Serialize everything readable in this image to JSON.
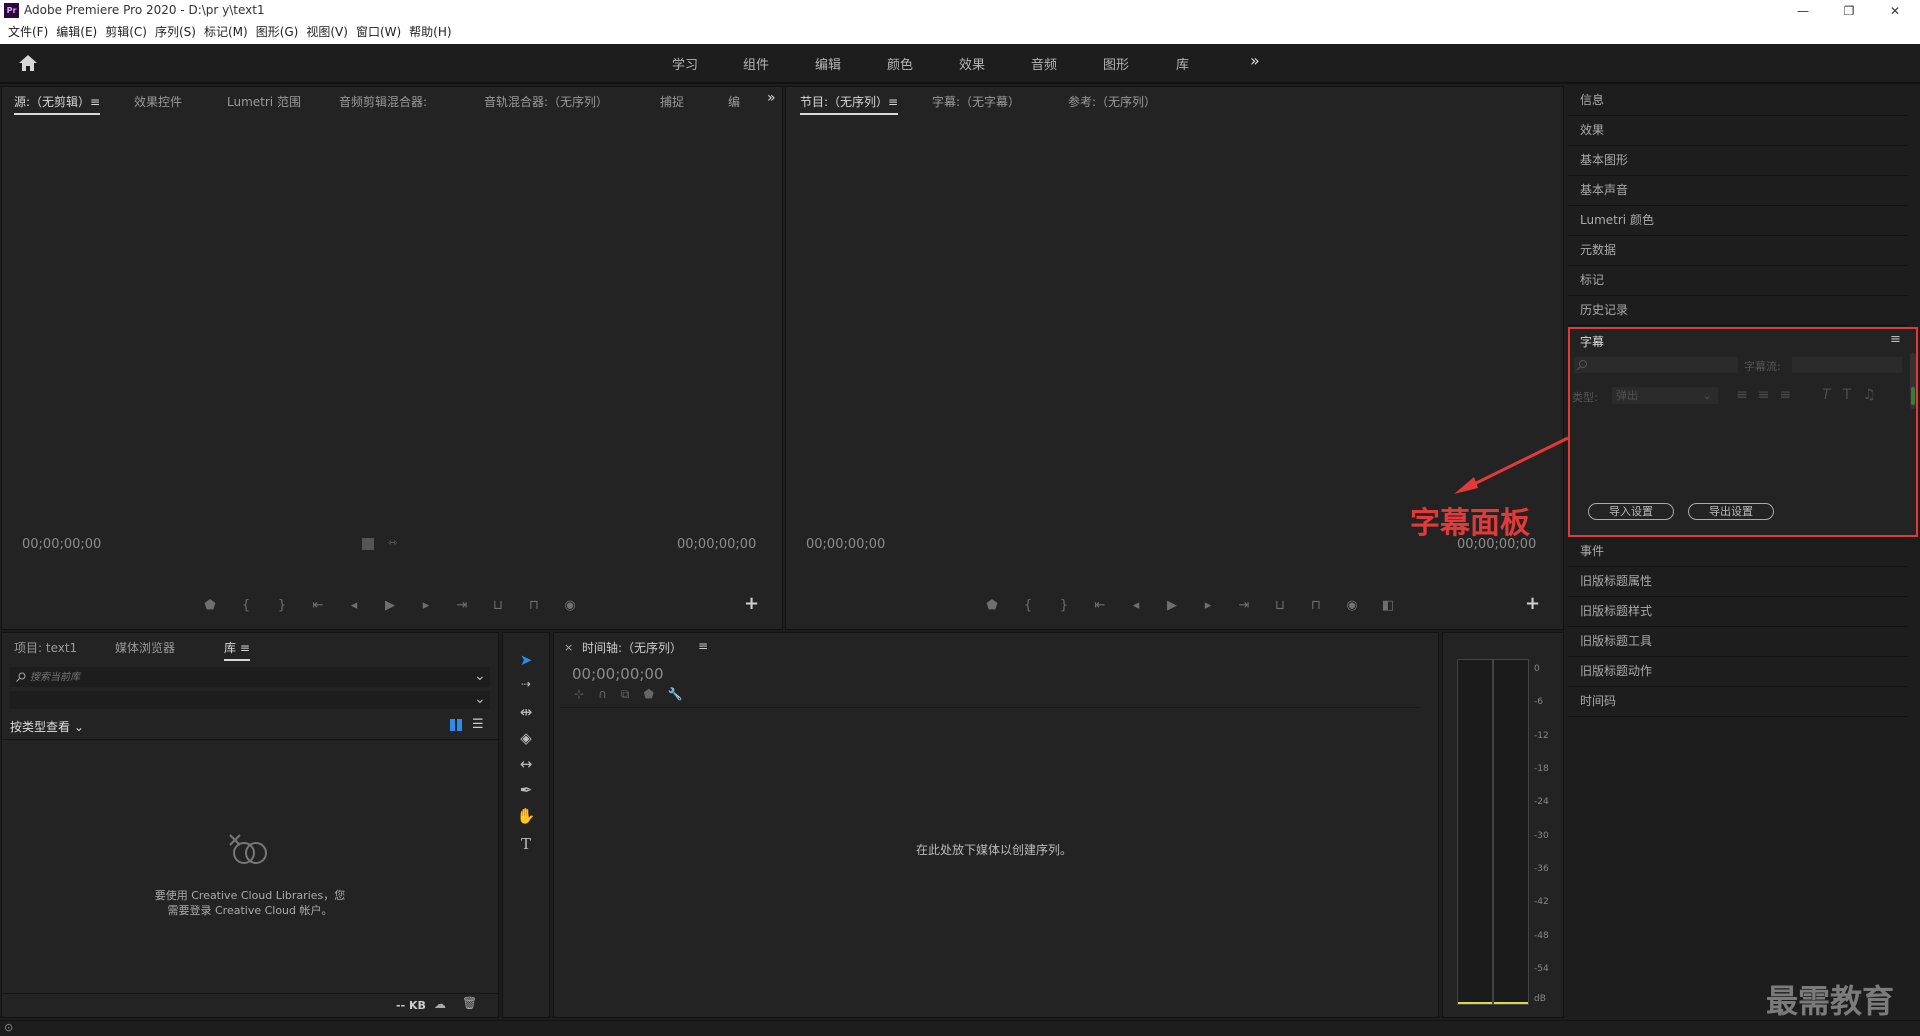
{
  "window": {
    "title": "Adobe Premiere Pro 2020 - D:\\pr y\\text1",
    "logo": "Pr",
    "min": "—",
    "restore": "❐",
    "close": "✕"
  },
  "menu": [
    "文件(F)",
    "编辑(E)",
    "剪辑(C)",
    "序列(S)",
    "标记(M)",
    "图形(G)",
    "视图(V)",
    "窗口(W)",
    "帮助(H)"
  ],
  "workspaces": [
    "学习",
    "组件",
    "编辑",
    "颜色",
    "效果",
    "音频",
    "图形",
    "库"
  ],
  "workspace_more": "»",
  "source_panel": {
    "tabs": [
      "源:（无剪辑）≡",
      "效果控件",
      "Lumetri 范围",
      "音频剪辑混合器:",
      "音轨混合器:（无序列）",
      "捕捉",
      "编"
    ],
    "more": "»",
    "tc_left": "00;00;00;00",
    "tc_right": "00;00;00;00"
  },
  "program_panel": {
    "tabs": [
      "节目:（无序列）≡",
      "字幕:（无字幕）",
      "参考:（无序列）"
    ],
    "tc_left": "00;00;00;00",
    "tc_right": "00;00;00;00"
  },
  "right_panels_top": [
    "信息",
    "效果",
    "基本图形",
    "基本声音",
    "Lumetri 颜色",
    "元数据",
    "标记",
    "历史记录"
  ],
  "captions_panel": {
    "title": "字幕",
    "menu": "≡",
    "stream_label": "字幕流:",
    "type_label": "类型:",
    "type_value": "弹出",
    "import_btn": "导入设置",
    "export_btn": "导出设置"
  },
  "annotation": "字幕面板",
  "right_panels_bottom": [
    "事件",
    "旧版标题属性",
    "旧版标题样式",
    "旧版标题工具",
    "旧版标题动作",
    "时间码"
  ],
  "project_panel": {
    "tabs": [
      "项目: text1",
      "媒体浏览器",
      "库"
    ],
    "search_placeholder": "搜索当前库",
    "view_by": "按类型查看",
    "message_line1": "要使用 Creative Cloud Libraries，您",
    "message_line2": "需要登录 Creative Cloud 帐户。",
    "size": "-- KB"
  },
  "timeline_panel": {
    "tab": "时间轴:（无序列）",
    "menu": "≡",
    "close": "×",
    "timecode": "00;00;00;00",
    "drop_message": "在此处放下媒体以创建序列。"
  },
  "audio_meter": {
    "labels": [
      "0",
      "-6",
      "-12",
      "-18",
      "-24",
      "-30",
      "-36",
      "-42",
      "-48",
      "-54",
      "dB"
    ]
  },
  "watermark": "最需教育",
  "colors": {
    "accent_red": "#e23a3a",
    "selection_tool": "#2d8ceb"
  }
}
